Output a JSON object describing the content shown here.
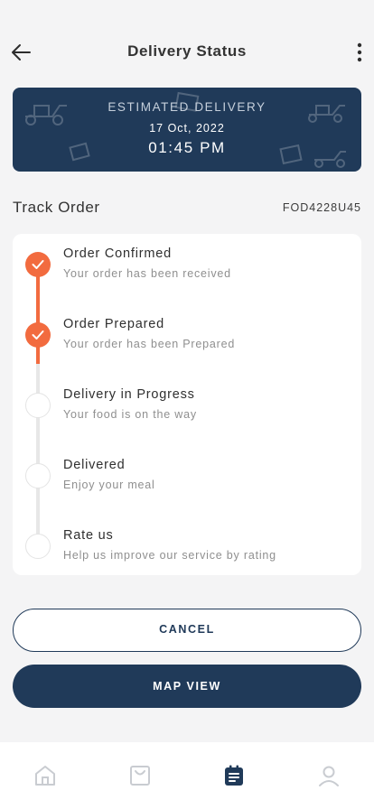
{
  "header": {
    "title": "Delivery Status",
    "back_icon": "arrow-left-icon",
    "menu_icon": "more-vertical-icon"
  },
  "estimate": {
    "label": "ESTIMATED DELIVERY",
    "date": "17 Oct, 2022",
    "time": "01:45 PM"
  },
  "track": {
    "title": "Track Order",
    "order_id": "FOD4228U45"
  },
  "steps": [
    {
      "title": "Order Confirmed",
      "subtitle": "Your order has been received",
      "done": true
    },
    {
      "title": "Order Prepared",
      "subtitle": "Your order has been Prepared",
      "done": true
    },
    {
      "title": "Delivery in Progress",
      "subtitle": "Your food is on the way",
      "done": false
    },
    {
      "title": "Delivered",
      "subtitle": "Enjoy your meal",
      "done": false
    },
    {
      "title": "Rate us",
      "subtitle": "Help us improve our service by rating",
      "done": false
    }
  ],
  "actions": {
    "cancel_label": "CANCEL",
    "map_label": "MAP VIEW"
  },
  "nav": [
    {
      "icon": "home-icon",
      "active": false
    },
    {
      "icon": "shopping-bag-icon",
      "active": false
    },
    {
      "icon": "orders-icon",
      "active": true
    },
    {
      "icon": "profile-icon",
      "active": false
    }
  ],
  "colors": {
    "primary": "#203a59",
    "accent": "#f26b3f",
    "background": "#f4f4f5"
  }
}
